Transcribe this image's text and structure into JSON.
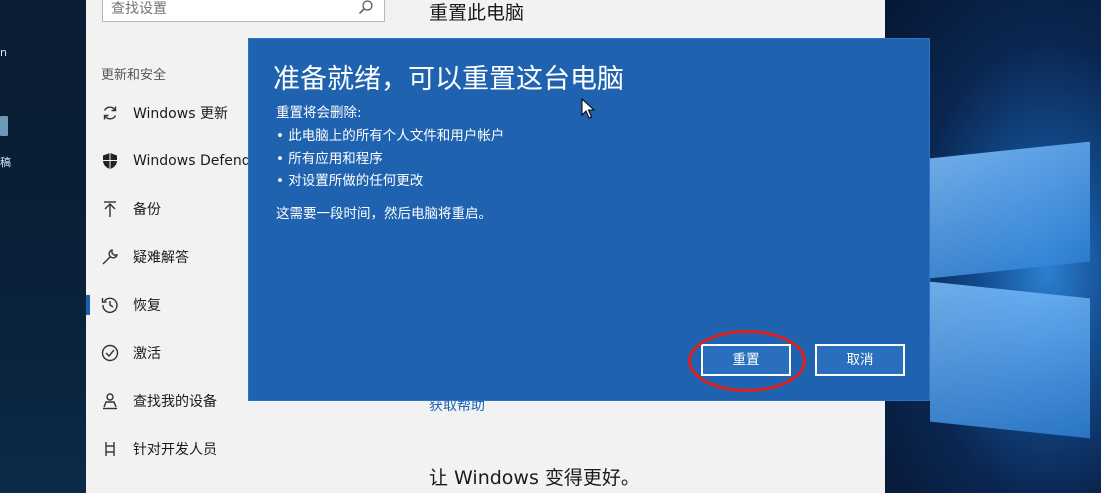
{
  "desktop": {
    "icon_chars": [
      "n",
      "稿"
    ]
  },
  "search": {
    "placeholder": "查找设置"
  },
  "sidebar": {
    "section_title": "更新和安全",
    "items": [
      {
        "label": "Windows 更新",
        "icon": "sync-icon"
      },
      {
        "label": "Windows Defender",
        "icon": "shield-icon"
      },
      {
        "label": "备份",
        "icon": "backup-arrow-icon"
      },
      {
        "label": "疑难解答",
        "icon": "wrench-icon"
      },
      {
        "label": "恢复",
        "icon": "history-icon",
        "active": true
      },
      {
        "label": "激活",
        "icon": "check-circle-icon"
      },
      {
        "label": "查找我的设备",
        "icon": "person-pin-icon"
      },
      {
        "label": "针对开发人员",
        "icon": "developer-icon"
      }
    ]
  },
  "content": {
    "title": "重置此电脑",
    "help_link": "获取帮助",
    "feedback_heading": "让 Windows 变得更好。"
  },
  "dialog": {
    "title": "准备就绪，可以重置这台电脑",
    "remove_intro": "重置将会删除:",
    "bullets": [
      "此电脑上的所有个人文件和用户帐户",
      "所有应用和程序",
      "对设置所做的任何更改"
    ],
    "note": "这需要一段时间，然后电脑将重启。",
    "reset_label": "重置",
    "cancel_label": "取消"
  },
  "colors": {
    "dialog_bg": "#1e62b0",
    "accent": "#1e5fb5",
    "highlight_circle": "#e0201c"
  }
}
